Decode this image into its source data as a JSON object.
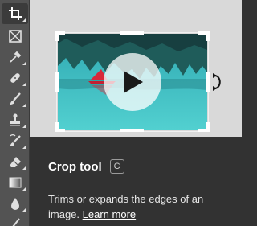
{
  "toolbar": {
    "tools": [
      {
        "name": "crop-tool",
        "icon": "crop-icon",
        "active": true
      },
      {
        "name": "frame-tool",
        "icon": "frame-icon",
        "active": false
      },
      {
        "name": "eyedropper-tool",
        "icon": "eyedropper-icon",
        "active": false
      },
      {
        "name": "healing-brush-tool",
        "icon": "bandage-icon",
        "active": false
      },
      {
        "name": "brush-tool",
        "icon": "brush-icon",
        "active": false
      },
      {
        "name": "clone-stamp-tool",
        "icon": "stamp-icon",
        "active": false
      },
      {
        "name": "history-brush-tool",
        "icon": "history-brush-icon",
        "active": false
      },
      {
        "name": "eraser-tool",
        "icon": "eraser-icon",
        "active": false
      },
      {
        "name": "gradient-tool",
        "icon": "gradient-icon",
        "active": false
      },
      {
        "name": "blur-tool",
        "icon": "drop-icon",
        "active": false
      },
      {
        "name": "dodge-tool",
        "icon": "dodge-icon",
        "active": false
      }
    ]
  },
  "tooltip": {
    "title": "Crop tool",
    "shortcut": "C",
    "description": "Trims or expands the edges of an image.",
    "link_label": "Learn more"
  },
  "colors": {
    "toolbar_bg": "#535353",
    "panel_bg": "#323232",
    "preview_bg": "#d9d9d9",
    "lake": "#3fbfc4",
    "canoe": "#d8283a"
  }
}
